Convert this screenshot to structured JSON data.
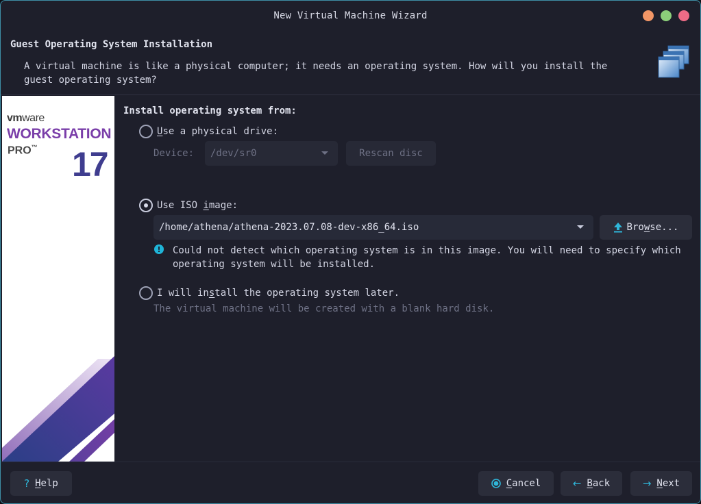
{
  "window": {
    "title": "New Virtual Machine Wizard",
    "controls": [
      {
        "name": "minimize",
        "color": "#f29666"
      },
      {
        "name": "maximize",
        "color": "#8ccf7a"
      },
      {
        "name": "close",
        "color": "#ee6b86"
      }
    ]
  },
  "header": {
    "title": "Guest Operating System Installation",
    "description": "A virtual machine is like a physical computer; it needs an operating system. How will you install the guest operating system?",
    "icon": "virtual-machines-icon"
  },
  "branding": {
    "vendor": "vm",
    "vendor_suffix": "ware",
    "product": "WORKSTATION",
    "edition": "PRO",
    "trademark": "™",
    "version": "17",
    "accent_color": "#7a3ea9"
  },
  "content": {
    "section_label": "Install operating system from:",
    "physical_drive": {
      "label_first": "U",
      "label_rest": "se a physical drive:",
      "checked": false,
      "device_label": "Device:",
      "device_value": "/dev/sr0",
      "rescan_label": "Rescan disc",
      "enabled": false
    },
    "iso_image": {
      "label_pre": "Use ISO ",
      "label_mnemonic": "i",
      "label_post": "mage:",
      "checked": true,
      "path": "/home/athena/athena-2023.07.08-dev-x86_64.iso",
      "browse_pre": "Bro",
      "browse_mnemonic": "w",
      "browse_post": "se...",
      "warning_icon": "info-circle-icon",
      "warning": "Could not detect which operating system is in this image. You will need to specify which operating system will be installed."
    },
    "install_later": {
      "label_pre": "I will in",
      "label_mnemonic": "s",
      "label_post": "tall the operating system later.",
      "checked": false,
      "description": "The virtual machine will be created with a blank hard disk."
    }
  },
  "footer": {
    "help": {
      "icon": "?",
      "mnemonic": "H",
      "rest": "elp"
    },
    "cancel": {
      "mnemonic": "C",
      "rest": "ancel"
    },
    "back": {
      "icon": "←",
      "mnemonic": "B",
      "rest": "ack"
    },
    "next": {
      "icon": "→",
      "mnemonic": "N",
      "rest": "ext"
    },
    "accent_color": "#2fb6d9"
  }
}
